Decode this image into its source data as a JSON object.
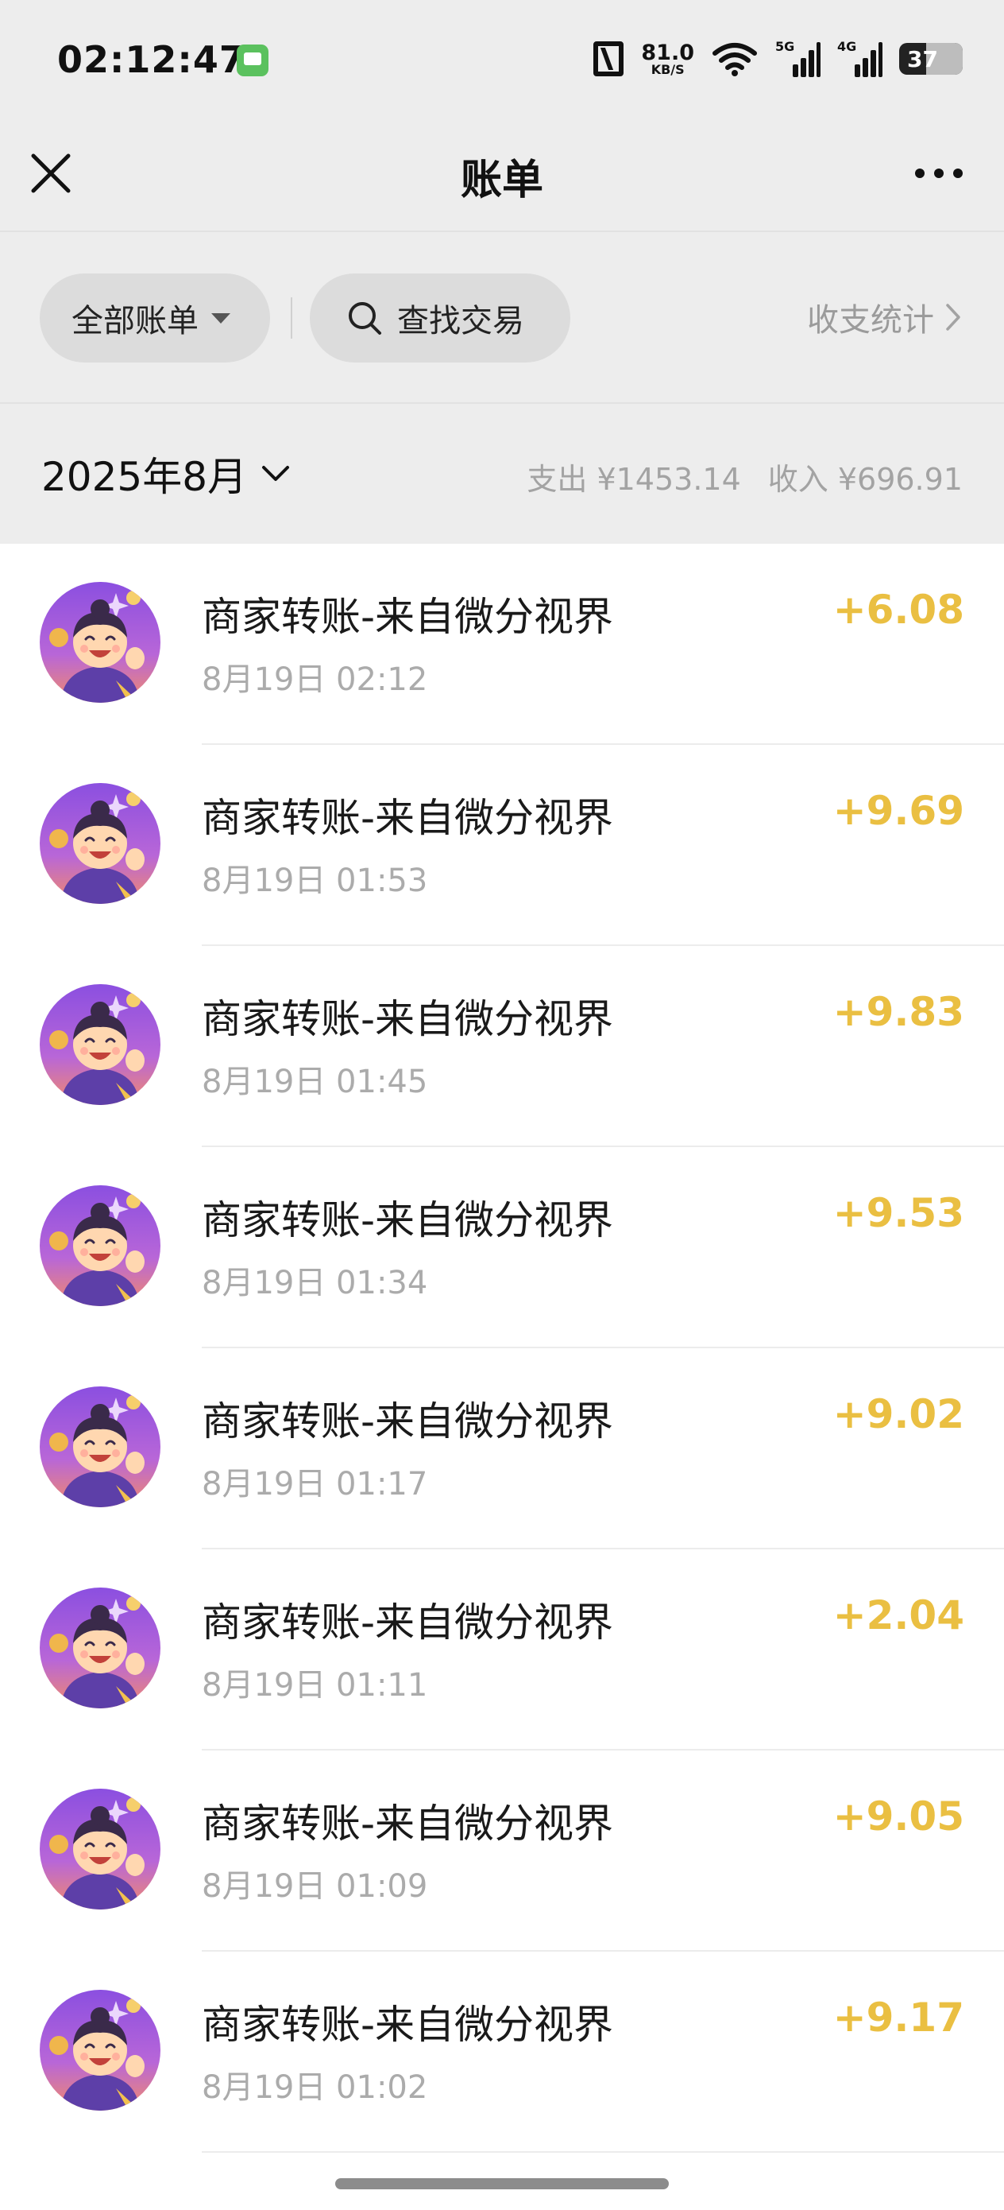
{
  "status_bar": {
    "time": "02:12:47",
    "net_speed_value": "81.0",
    "net_speed_unit": "KB/S",
    "signal1_label": "5G",
    "signal2_label": "4G",
    "battery": "37"
  },
  "nav": {
    "title": "账单"
  },
  "filters": {
    "all_bills": "全部账单",
    "search": "查找交易",
    "stats": "收支统计"
  },
  "month": {
    "label": "2025年8月",
    "expense": "支出 ¥1453.14",
    "income": "收入 ¥696.91"
  },
  "transactions": [
    {
      "title": "商家转账-来自微分视界",
      "time": "8月19日 02:12",
      "amount": "+6.08"
    },
    {
      "title": "商家转账-来自微分视界",
      "time": "8月19日 01:53",
      "amount": "+9.69"
    },
    {
      "title": "商家转账-来自微分视界",
      "time": "8月19日 01:45",
      "amount": "+9.83"
    },
    {
      "title": "商家转账-来自微分视界",
      "time": "8月19日 01:34",
      "amount": "+9.53"
    },
    {
      "title": "商家转账-来自微分视界",
      "time": "8月19日 01:17",
      "amount": "+9.02"
    },
    {
      "title": "商家转账-来自微分视界",
      "time": "8月19日 01:11",
      "amount": "+2.04"
    },
    {
      "title": "商家转账-来自微分视界",
      "time": "8月19日 01:09",
      "amount": "+9.05"
    },
    {
      "title": "商家转账-来自微分视界",
      "time": "8月19日 01:02",
      "amount": "+9.17"
    }
  ],
  "colors": {
    "income_amount": "#eabf42",
    "background": "#ededed"
  }
}
